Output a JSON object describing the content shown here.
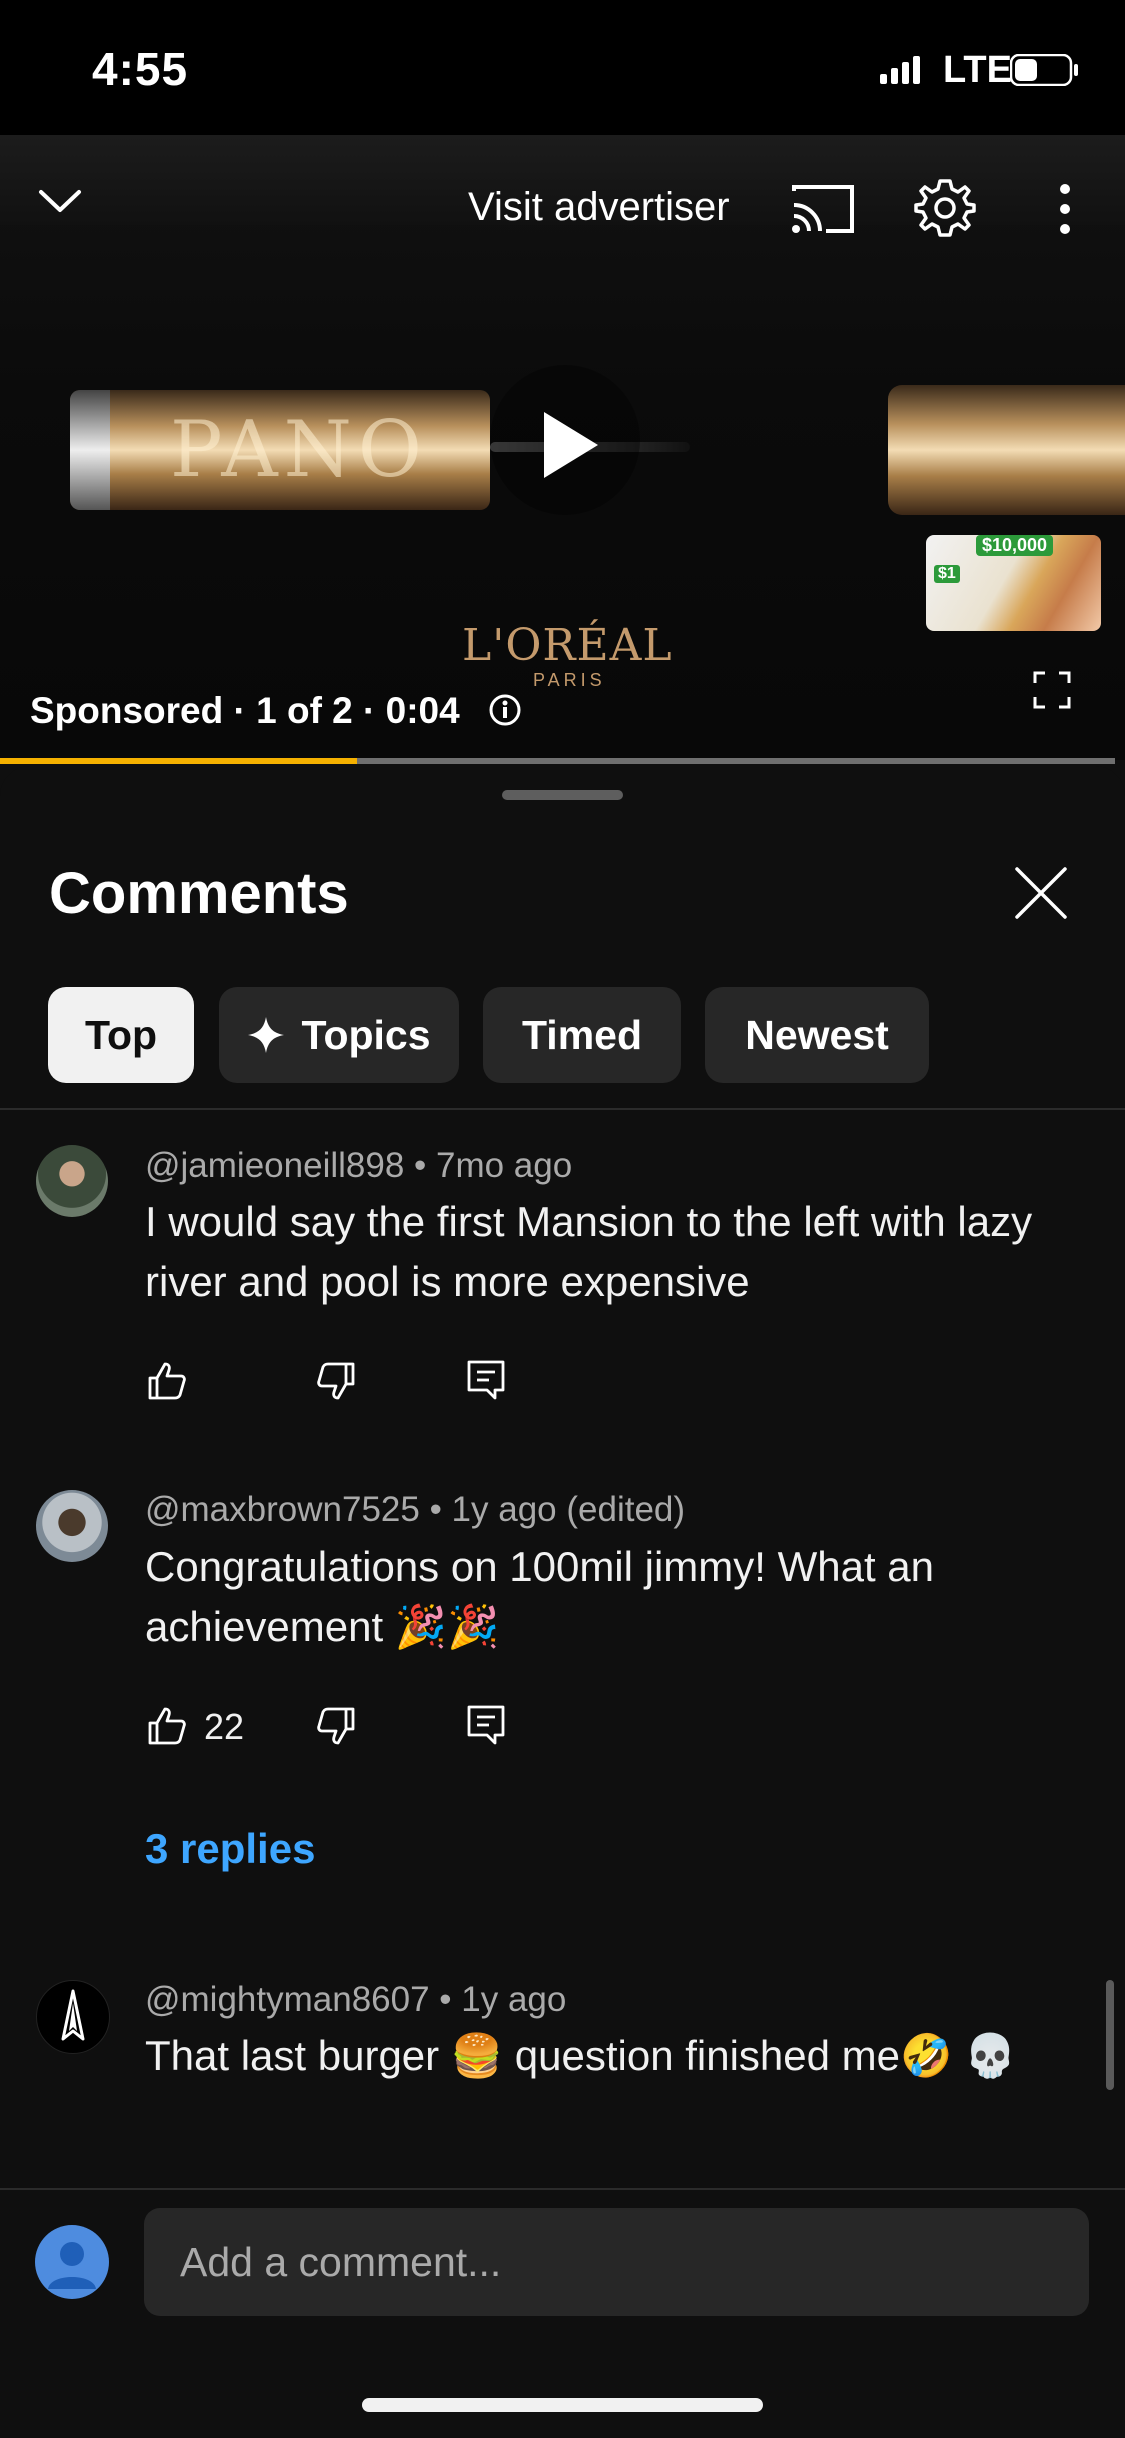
{
  "status_bar": {
    "time": "4:55",
    "network": "LTE"
  },
  "player": {
    "visit_label": "Visit advertiser",
    "brand": "L'ORÉAL",
    "brand_sub": "PARIS",
    "product_text": "PANO",
    "ad_info": "Sponsored · 1 of 2 · 0:04",
    "ad_progress": 0.32,
    "thumbnail": {
      "price_big": "$10,000",
      "price_small": "$1"
    }
  },
  "comments": {
    "title": "Comments",
    "chips": [
      "Top",
      "Topics",
      "Timed",
      "Newest"
    ],
    "active_chip": "Top",
    "items": [
      {
        "handle": "@jamieoneill898",
        "meta": " • 7mo ago",
        "text": "I would say the first Mansion to the left with lazy river and pool is more expensive",
        "likes": ""
      },
      {
        "handle": "@maxbrown7525",
        "meta": " • 1y ago (edited)",
        "text": "Congratulations on 100mil jimmy! What an achievement 🎉🎉",
        "likes": "22"
      },
      {
        "handle": "@mightyman8607",
        "meta": " • 1y ago",
        "text": "That last burger 🍔 question finished me🤣 💀",
        "likes": ""
      }
    ],
    "replies_label": "3 replies"
  },
  "composer": {
    "placeholder": "Add a comment..."
  },
  "colors": {
    "accent_blue": "#3ea6ff",
    "ad_progress": "#f5b100",
    "background": "#0f0f0f",
    "chip": "#272727"
  }
}
